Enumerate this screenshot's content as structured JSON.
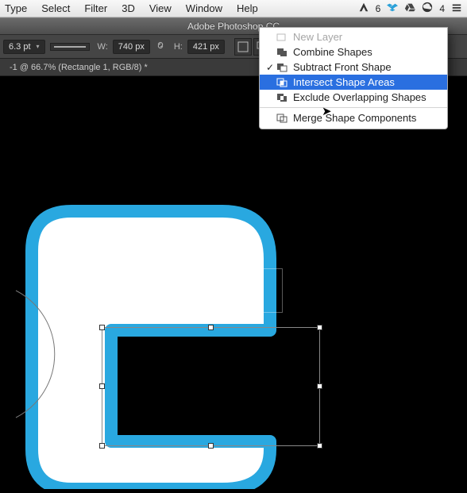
{
  "menubar": {
    "items": [
      "Type",
      "Select",
      "Filter",
      "3D",
      "View",
      "Window",
      "Help"
    ],
    "status_label": "6",
    "adobe_cc_label": "4"
  },
  "titlebar": {
    "title": "Adobe Photoshop CC"
  },
  "options": {
    "stroke_pt": "6.3 pt",
    "width_label": "W:",
    "width_value": "740 px",
    "height_label": "H:",
    "height_value": "421 px"
  },
  "doc_tab": {
    "label": "-1 @ 66.7% (Rectangle 1, RGB/8) *"
  },
  "context_menu": {
    "items": [
      {
        "label": "New Layer",
        "disabled": true,
        "icon": "new-layer-icon"
      },
      {
        "label": "Combine Shapes",
        "icon": "combine-icon"
      },
      {
        "label": "Subtract Front Shape",
        "checked": true,
        "icon": "subtract-icon"
      },
      {
        "label": "Intersect Shape Areas",
        "highlight": true,
        "icon": "intersect-icon"
      },
      {
        "label": "Exclude Overlapping Shapes",
        "icon": "exclude-icon"
      },
      {
        "sep": true
      },
      {
        "label": "Merge Shape Components",
        "icon": "merge-icon"
      }
    ]
  },
  "colors": {
    "accent": "#2a6fe0",
    "shape_stroke": "#29a8e0"
  }
}
